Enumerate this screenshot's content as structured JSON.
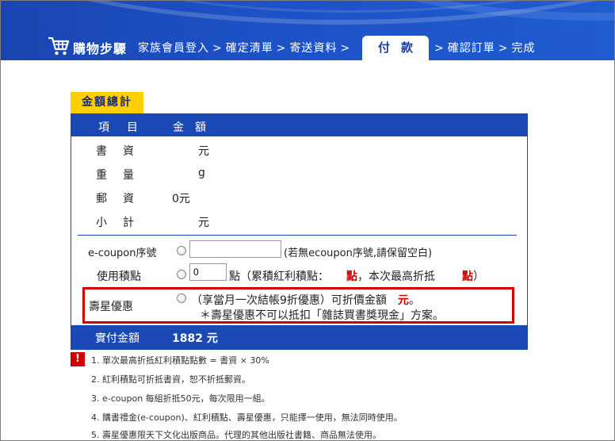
{
  "header": {
    "step_title": "購物步驟",
    "steps_before": [
      "家族會員登入",
      "確定清單",
      "寄送資料"
    ],
    "active_step": "付款",
    "steps_after": [
      "確認訂單",
      "完成"
    ],
    "separator": ">"
  },
  "section": {
    "title": "金額總計"
  },
  "table": {
    "header": {
      "item": "項目",
      "amount": "金額"
    },
    "rows": [
      {
        "label": "書資",
        "value": "元"
      },
      {
        "label": "重量",
        "value": "g"
      },
      {
        "label": "郵資",
        "value": "0元"
      },
      {
        "label": "小計",
        "value": "元"
      }
    ]
  },
  "coupon": {
    "label": "e-coupon序號",
    "value": "",
    "note": "(若無ecoupon序號,請保留空白)"
  },
  "points": {
    "label": "使用積點",
    "value": "0",
    "text_before": "點（累積紅利積點：",
    "red_mark1": "點",
    "text_middle": "，本次最高折抵",
    "red_mark2": "點",
    "text_after": "）"
  },
  "discount": {
    "label": "壽星優惠",
    "line1_before": "（享當月一次結帳9折優惠）可折價金額",
    "line1_red": "元",
    "line1_after": "。",
    "line2": "＊壽星優惠不可以抵扣「雜誌買書獎現金」方案。"
  },
  "total": {
    "label": "實付金額",
    "value": "1882 元"
  },
  "notes": {
    "icon": "!",
    "items": [
      "1. 單次最高折抵紅利積點點數 = 書資 × 30%",
      "2. 紅利積點可折抵書資，恕不折抵郵資。",
      "3. e-coupon 每組折抵50元，每次限用一組。",
      "4. 購書禮金(e-coupon)、紅利積點、壽星優惠，只能擇一使用，無法同時使用。",
      "5. 壽星優惠限天下文化出版商品。代理的其他出版社書籍、商品無法使用。"
    ]
  },
  "colors": {
    "primary_blue": "#1a49b5",
    "accent_yellow": "#ffd000",
    "alert_red": "#d40000"
  }
}
